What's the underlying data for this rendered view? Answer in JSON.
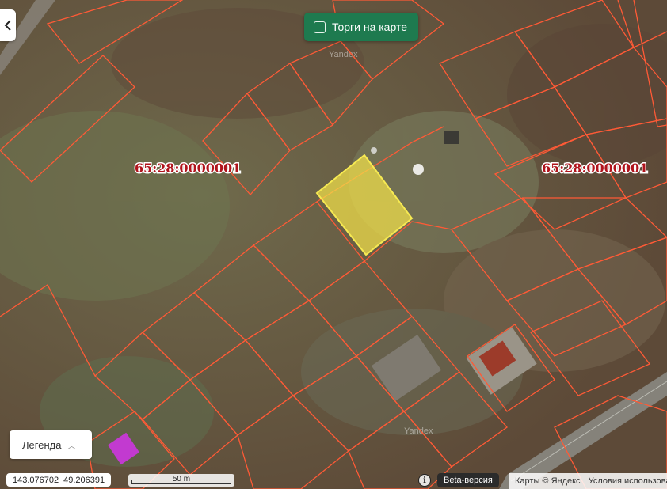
{
  "toolbar": {
    "auction_toggle_label": "Торги на карте"
  },
  "legend": {
    "label": "Легенда"
  },
  "map": {
    "cadastral_labels": [
      "65:28:0000001",
      "65:28:0000001"
    ],
    "watermark": "Yandex",
    "parcel_color": "#ff5a36",
    "selected_color": "#f2e04a"
  },
  "status": {
    "longitude": "143.076702",
    "latitude": "49.206391",
    "scale_label": "50 m",
    "beta_label": "Beta-версия",
    "copyright": "Карты © Яндекс",
    "terms": "Условия использования"
  },
  "icons": {
    "back": "chevron-left-icon",
    "info": "info-icon",
    "legend_chevron": "chevron-up-icon"
  }
}
